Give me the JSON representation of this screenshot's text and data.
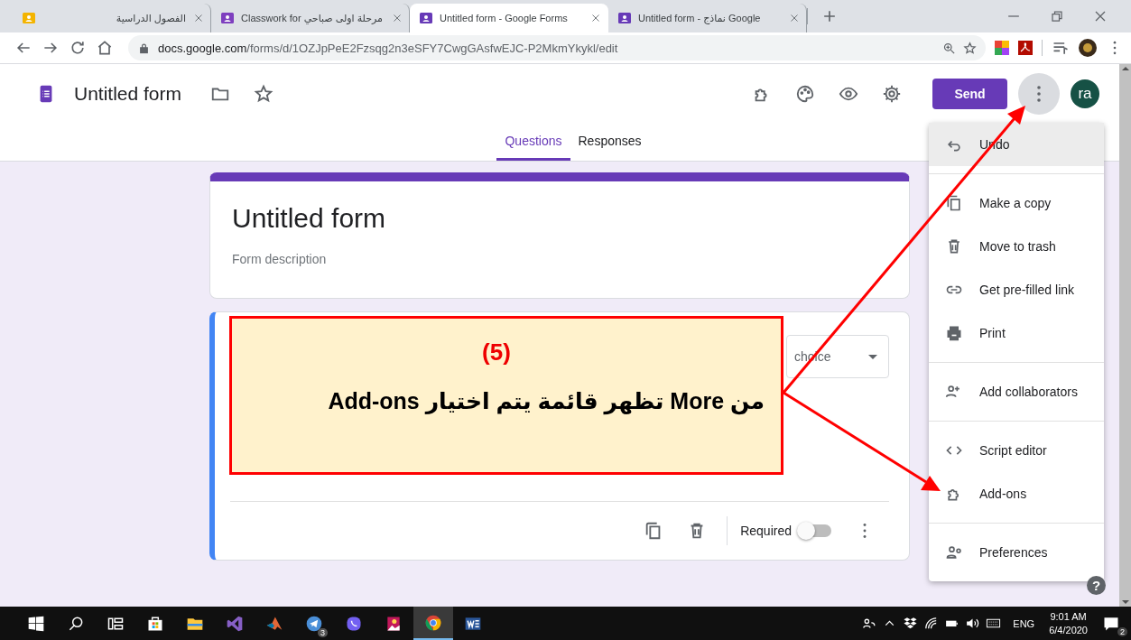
{
  "browser": {
    "tabs": [
      {
        "title": "الفصول الدراسية",
        "color": "#f4b400",
        "selected": false
      },
      {
        "title": "Classwork for مرحلة اولى صباحي",
        "color": "#7e3fbf",
        "selected": false
      },
      {
        "title": "Untitled form - Google Forms",
        "color": "#673ab7",
        "selected": true
      },
      {
        "title": "Untitled form - نماذج Google",
        "color": "#673ab7",
        "selected": false
      }
    ],
    "url_host": "docs.google.com",
    "url_path": "/forms/d/1OZJpPeE2Fzsqg2n3eSFY7CwgGAsfwEJC-P2MkmYkykl/edit"
  },
  "form_header": {
    "title": "Untitled form",
    "send": "Send",
    "avatar": "ra",
    "more_active": true
  },
  "tabs": [
    {
      "label": "Questions",
      "selected": true
    },
    {
      "label": "Responses",
      "selected": false
    }
  ],
  "form": {
    "title": "Untitled form",
    "description_placeholder": "Form description"
  },
  "question": {
    "type_dropdown": "choice",
    "required_label": "Required",
    "required": false
  },
  "more_menu": {
    "groups": [
      {
        "items": [
          {
            "kind": "undo",
            "label": "Undo",
            "highlighted": true
          }
        ]
      },
      {
        "items": [
          {
            "kind": "copy",
            "label": "Make a copy",
            "highlighted": false
          },
          {
            "kind": "trash",
            "label": "Move to trash",
            "highlighted": false
          },
          {
            "kind": "link",
            "label": "Get pre-filled link",
            "highlighted": false
          },
          {
            "kind": "print",
            "label": "Print",
            "highlighted": false
          }
        ]
      },
      {
        "items": [
          {
            "kind": "collaborators",
            "label": "Add collaborators",
            "highlighted": false
          }
        ]
      },
      {
        "items": [
          {
            "kind": "code",
            "label": "Script editor",
            "highlighted": false
          },
          {
            "kind": "addon",
            "label": "Add-ons",
            "highlighted": false
          }
        ]
      },
      {
        "items": [
          {
            "kind": "preferences",
            "label": "Preferences",
            "highlighted": false
          }
        ]
      }
    ]
  },
  "annotation": {
    "step": "(5)",
    "text": "من More تظهر قائمة يتم اختيار Add-ons"
  },
  "help": "?",
  "taskbar": {
    "apps": [
      {
        "kind": "start",
        "active": false
      },
      {
        "kind": "search",
        "active": false
      },
      {
        "kind": "taskview",
        "active": false
      },
      {
        "kind": "store",
        "active": false
      },
      {
        "kind": "explorer",
        "active": false
      },
      {
        "kind": "visualstudio",
        "active": false
      },
      {
        "kind": "matlab",
        "active": false
      },
      {
        "kind": "telegram",
        "active": false,
        "badge": "3"
      },
      {
        "kind": "viber",
        "active": false
      },
      {
        "kind": "photos",
        "active": false
      },
      {
        "kind": "chrome",
        "active": true
      },
      {
        "kind": "word",
        "active": false
      }
    ],
    "language": "ENG",
    "time": "9:01 AM",
    "date": "6/4/2020",
    "notifications": "2"
  }
}
